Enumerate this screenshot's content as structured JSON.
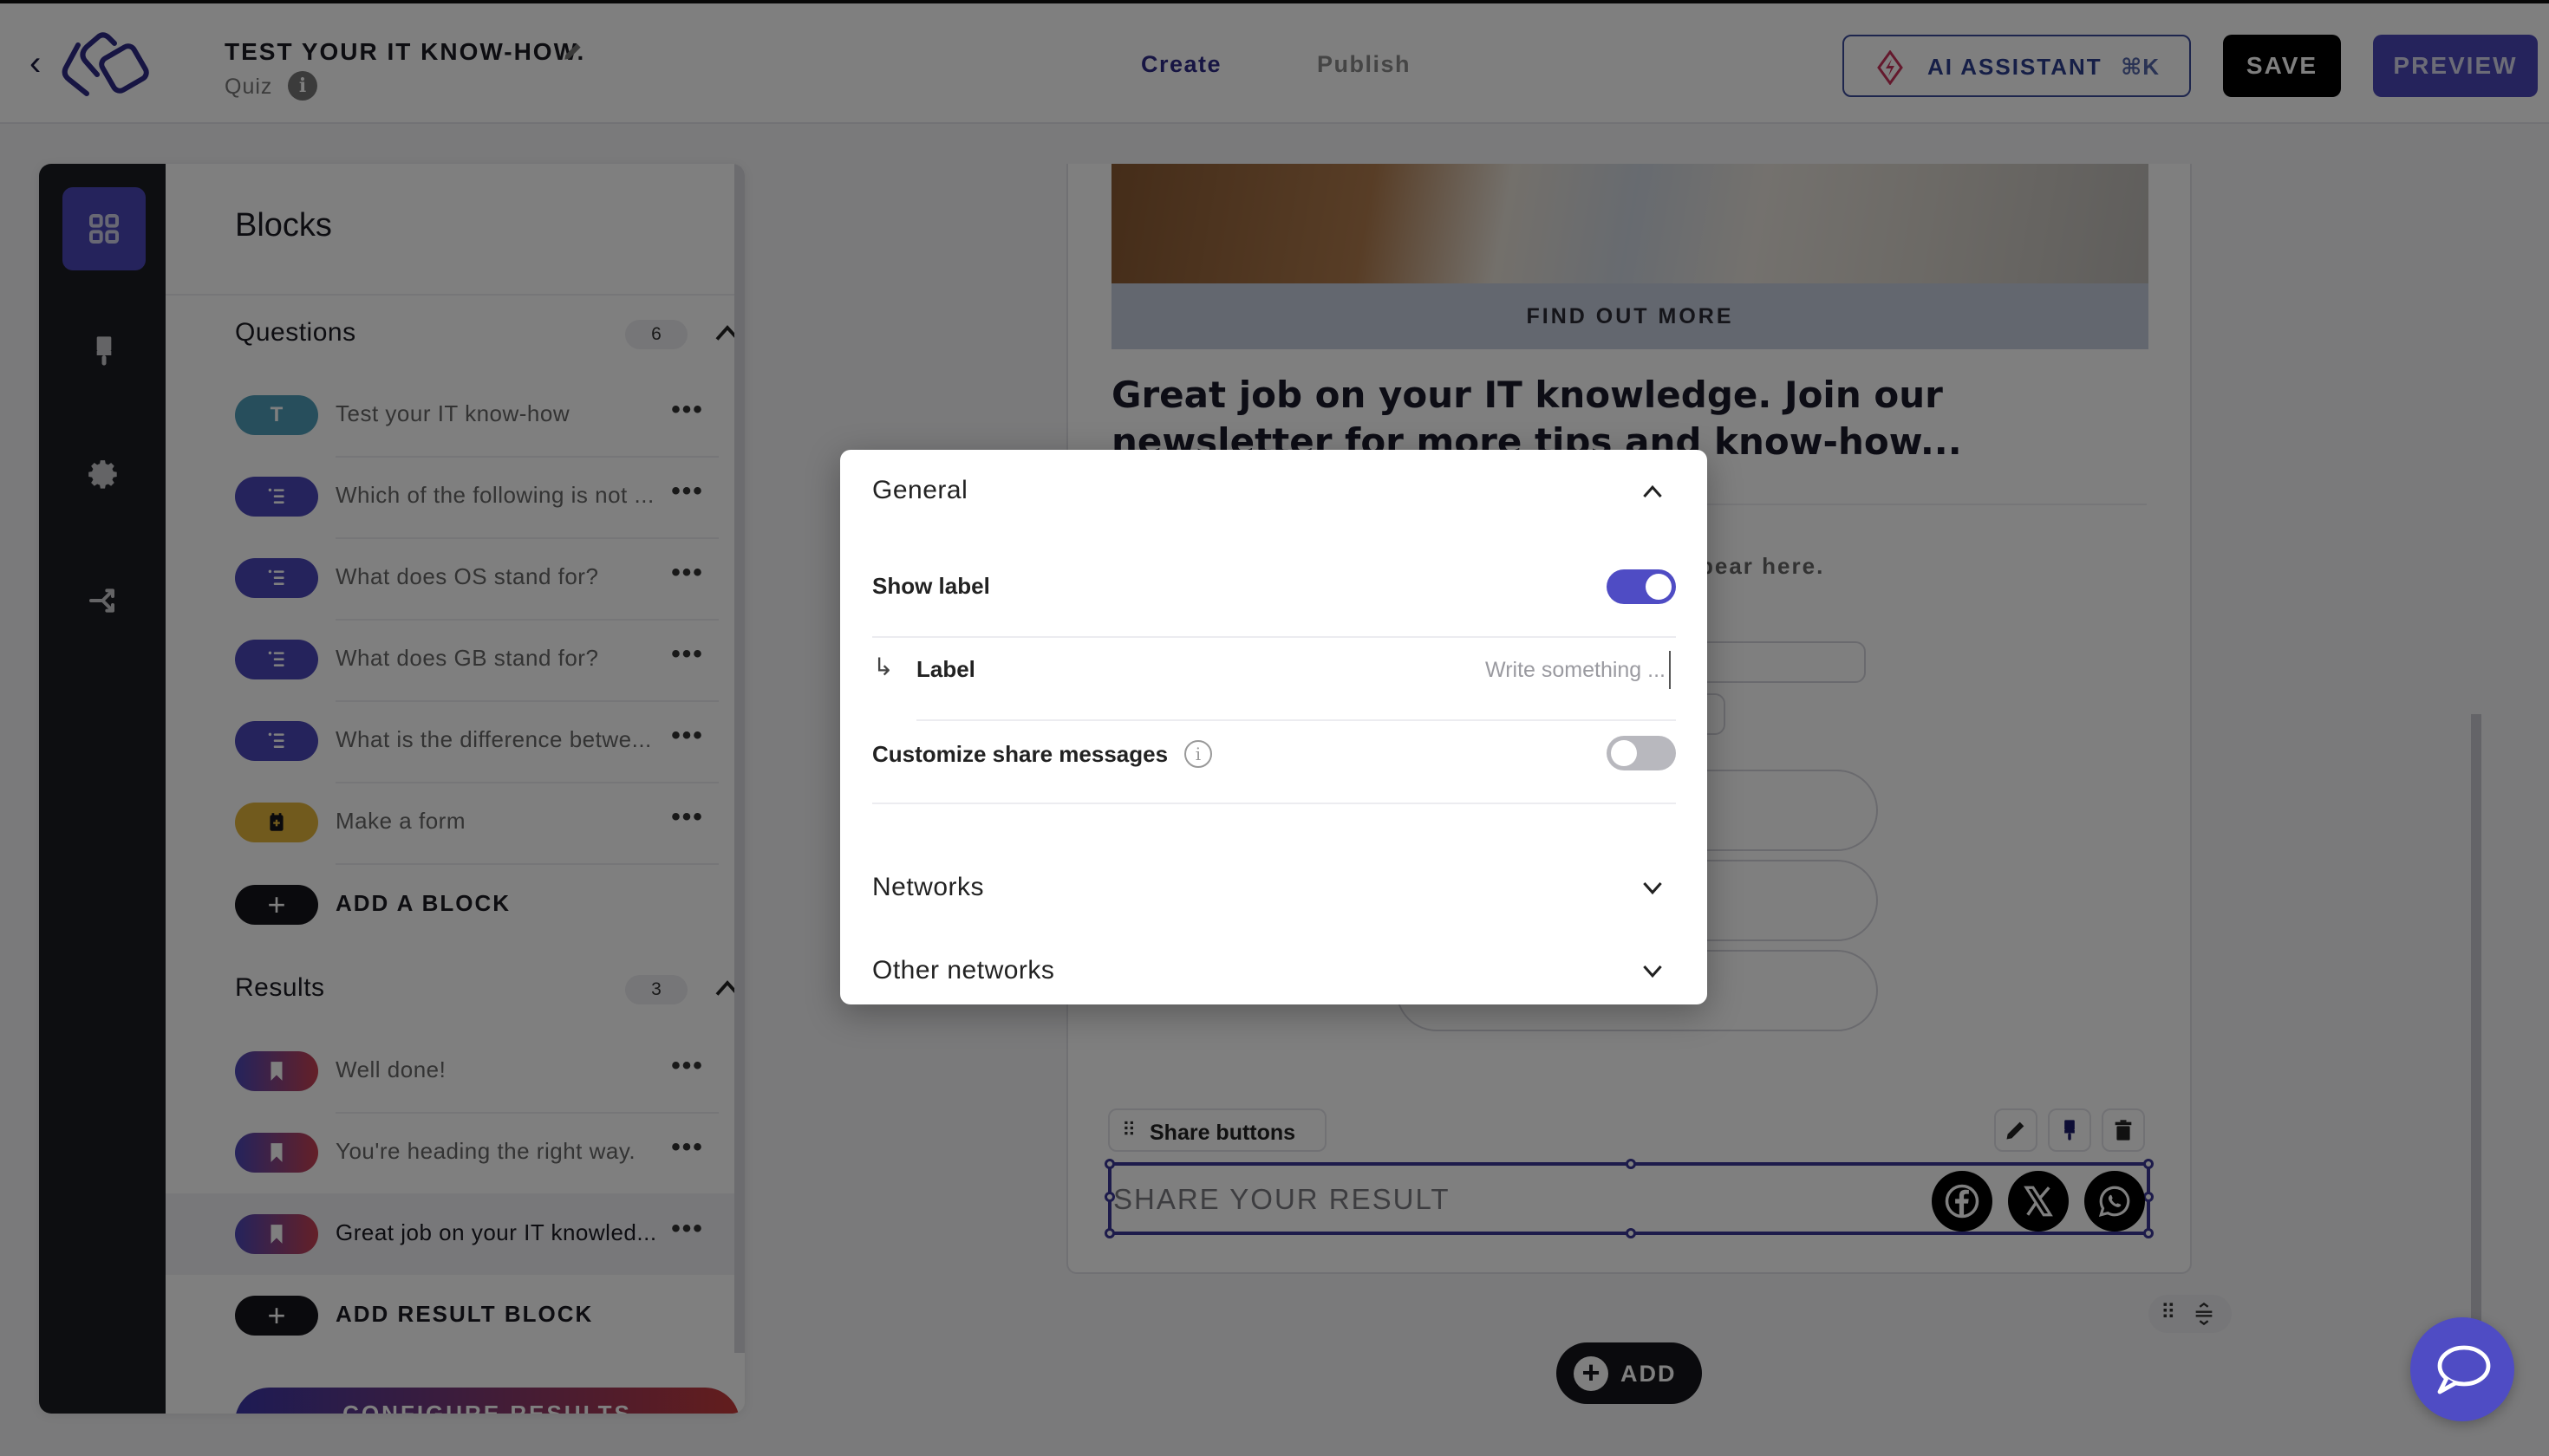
{
  "header": {
    "project_title": "TEST YOUR IT KNOW-HOW.",
    "project_type": "Quiz",
    "tabs": [
      {
        "label": "Create",
        "active": true
      },
      {
        "label": "Publish",
        "active": false
      }
    ],
    "ai_assistant": {
      "label": "AI ASSISTANT",
      "shortcut": "⌘K"
    },
    "save_label": "SAVE",
    "preview_label": "PREVIEW"
  },
  "rail": {
    "items": [
      {
        "name": "blocks",
        "icon": "grid-icon",
        "active": true
      },
      {
        "name": "design",
        "icon": "paintbrush-icon",
        "active": false
      },
      {
        "name": "settings",
        "icon": "gear-icon",
        "active": false
      },
      {
        "name": "logic",
        "icon": "branch-icon",
        "active": false
      }
    ]
  },
  "blocks_panel": {
    "title": "Blocks",
    "questions": {
      "title": "Questions",
      "count": "6",
      "items": [
        {
          "label": "Test your IT know-how",
          "type": "text",
          "icon_glyph": "T"
        },
        {
          "label": "Which of the following is not ...",
          "type": "list"
        },
        {
          "label": "What does OS stand for?",
          "type": "list"
        },
        {
          "label": "What does GB stand for?",
          "type": "list"
        },
        {
          "label": "What is the difference betwe...",
          "type": "list"
        },
        {
          "label": "Make a form",
          "type": "form"
        }
      ],
      "add_label": "ADD A BLOCK"
    },
    "results": {
      "title": "Results",
      "count": "3",
      "items": [
        {
          "label": "Well done!",
          "selected": false
        },
        {
          "label": "You're heading the right way.",
          "selected": false
        },
        {
          "label": "Great job on your IT knowled...",
          "selected": true
        }
      ],
      "add_label": "ADD RESULT BLOCK"
    },
    "configure_label": "CONFIGURE RESULTS"
  },
  "canvas": {
    "find_out_more": "FIND OUT MORE",
    "result_title": "Great job on your IT knowledge. Join our newsletter for more tips and know-how...",
    "ghost_text": "pear here.",
    "share_block": {
      "tag_label": "Share buttons",
      "share_text": "SHARE YOUR RESULT",
      "networks": [
        "facebook",
        "x",
        "whatsapp"
      ]
    },
    "add_label": "ADD"
  },
  "modal": {
    "general": {
      "title": "General",
      "expanded": true
    },
    "show_label": {
      "label": "Show label",
      "on": true
    },
    "label_field": {
      "label": "Label",
      "value": "",
      "placeholder": "Write something ..."
    },
    "customize_share": {
      "label": "Customize share messages",
      "on": false
    },
    "networks": {
      "title": "Networks",
      "expanded": false
    },
    "other_networks": {
      "title": "Other networks",
      "expanded": false
    }
  },
  "colors": {
    "brand": "#4a47b8",
    "toggle_on": "#4f4cc4",
    "save_bg": "#000000",
    "ai_border": "#3a4a9a",
    "ai_spark": "#c8325a"
  }
}
